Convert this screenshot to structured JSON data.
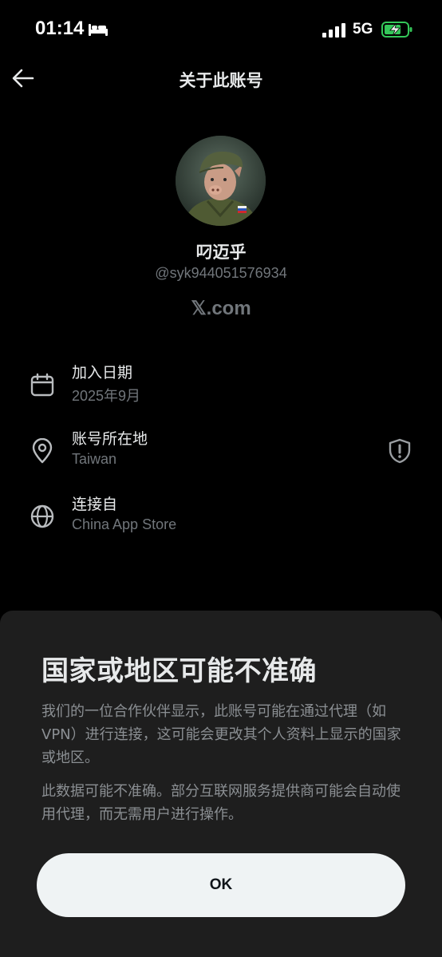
{
  "status_bar": {
    "time": "01:14",
    "network": "5G",
    "icons": [
      "bed-icon",
      "signal-icon",
      "battery-charging-icon"
    ]
  },
  "header": {
    "title": "关于此账号",
    "back_icon": "arrow-left-icon"
  },
  "profile": {
    "display_name": "叼迈乎",
    "handle": "@syk944051576934",
    "brand": "𝕏.com"
  },
  "info_rows": [
    {
      "icon": "calendar-icon",
      "label": "加入日期",
      "value": "2025年9月"
    },
    {
      "icon": "location-pin-icon",
      "label": "账号所在地",
      "value": "Taiwan",
      "trailing_icon": "shield-alert-icon"
    },
    {
      "icon": "globe-icon",
      "label": "连接自",
      "value": "China App Store"
    }
  ],
  "sheet": {
    "title": "国家或地区可能不准确",
    "paragraph1": "我们的一位合作伙伴显示，此账号可能在通过代理（如 VPN）进行连接，这可能会更改其个人资料上显示的国家或地区。",
    "paragraph2": "此数据可能不准确。部分互联网服务提供商可能会自动使用代理，而无需用户进行操作。",
    "ok_label": "OK"
  },
  "colors": {
    "background": "#000000",
    "sheet_background": "#1e1e1e",
    "primary_text": "#e7e9ea",
    "secondary_text": "#71767b",
    "button_background": "#eff3f4",
    "battery_charging": "#34c759"
  }
}
